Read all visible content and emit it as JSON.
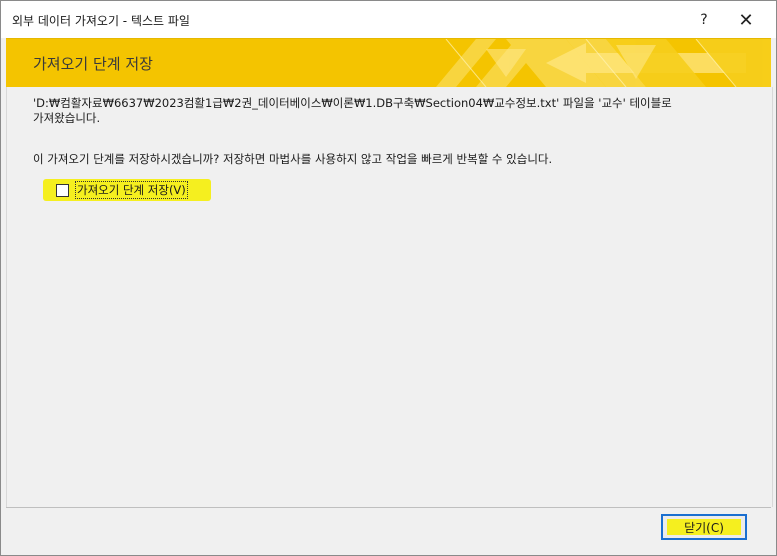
{
  "window": {
    "title": "외부 데이터 가져오기 - 텍스트 파일",
    "help_glyph": "?",
    "close_glyph": "✕"
  },
  "banner": {
    "title": "가져오기 단계 저장",
    "color": "#f4c400"
  },
  "content": {
    "message_line1": "'D:₩컴활자료₩6637₩2023컴활1급₩2권_데이터베이스₩이론₩1.DB구축₩Section04₩교수정보.txt' 파일을 '교수' 테이블로",
    "message_line2": "가져왔습니다.",
    "question": "이 가져오기 단계를 저장하시겠습니까? 저장하면 마법사를 사용하지 않고 작업을 빠르게 반복할 수 있습니다.",
    "save_steps_checkbox": {
      "label": "가져오기 단계 저장(V)",
      "checked": false
    }
  },
  "footer": {
    "close_button_label": "닫기(C)"
  },
  "colors": {
    "highlight": "#f5ef1f",
    "focus_border": "#1a6fd0",
    "dialog_bg": "#f0f0f0"
  }
}
